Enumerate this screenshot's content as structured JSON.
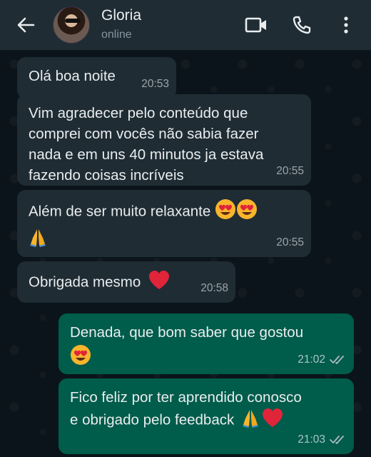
{
  "header": {
    "contact_name": "Gloria",
    "status": "online"
  },
  "messages": [
    {
      "direction": "in",
      "text": "Olá boa noite",
      "time": "20:53"
    },
    {
      "direction": "in",
      "lines": [
        "Vim agradecer pelo conteúdo que",
        "comprei com vocês não sabia fazer",
        "nada e em uns 40 minutos ja estava",
        "fazendo coisas incríveis"
      ],
      "time": "20:55"
    },
    {
      "direction": "in",
      "text": "Além de ser muito relaxante",
      "emojis": [
        "heart-eyes",
        "heart-eyes",
        "folded-hands"
      ],
      "time": "20:55"
    },
    {
      "direction": "in",
      "text": "Obrigada mesmo",
      "emojis": [
        "red-heart"
      ],
      "time": "20:58"
    },
    {
      "direction": "out",
      "text": "Denada, que bom saber que gostou",
      "emojis": [
        "heart-eyes"
      ],
      "time": "21:02",
      "status": "read"
    },
    {
      "direction": "out",
      "lines": [
        "Fico feliz por ter aprendido conosco",
        "e obrigado pelo feedback"
      ],
      "emojis": [
        "folded-hands",
        "red-heart"
      ],
      "time": "21:03",
      "status": "read"
    }
  ],
  "colors": {
    "background": "#0b141a",
    "header": "#1f2c34",
    "incoming_bubble": "#1f2c34",
    "outgoing_bubble": "#005c4b",
    "heart": "#e0243a",
    "emoji_face": "#f7b52c"
  }
}
